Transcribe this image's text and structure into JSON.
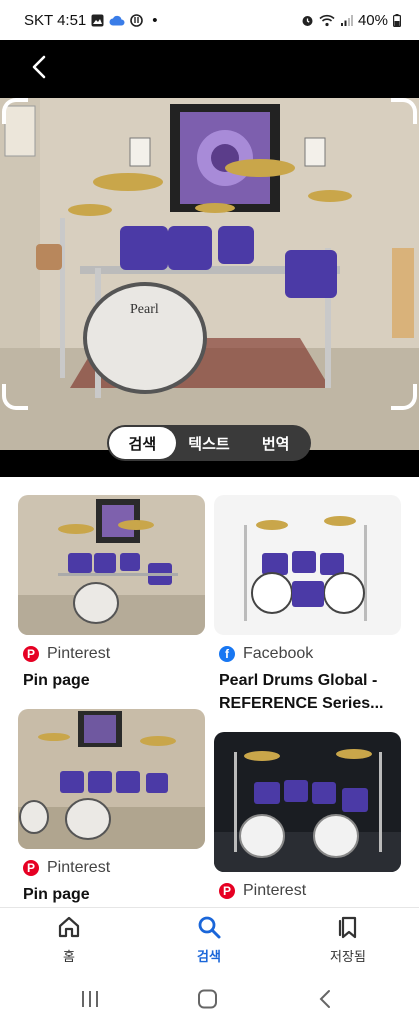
{
  "status": {
    "carrier_time": "SKT 4:51",
    "dot": "•",
    "battery": "40%"
  },
  "lens": {
    "segments": [
      {
        "label": "검색",
        "active": true
      },
      {
        "label": "텍스트",
        "active": false
      },
      {
        "label": "번역",
        "active": false
      }
    ]
  },
  "results": [
    {
      "source": "Pinterest",
      "title": "Pin page",
      "logo": "pinterest-icon"
    },
    {
      "source": "Facebook",
      "title": "Pearl Drums Global - REFERENCE Series...",
      "logo": "facebook-icon"
    },
    {
      "source": "Pinterest",
      "title": "Pin page",
      "logo": "pinterest-icon"
    },
    {
      "source": "Pinterest",
      "title": "",
      "logo": "pinterest-icon"
    }
  ],
  "bottom_nav": {
    "home": "홈",
    "search": "검색",
    "saved": "저장됨"
  },
  "colors": {
    "accent": "#1a66d9",
    "pinterest": "#e60023",
    "facebook": "#1877f2",
    "drum_shell": "#4b3aa6"
  }
}
